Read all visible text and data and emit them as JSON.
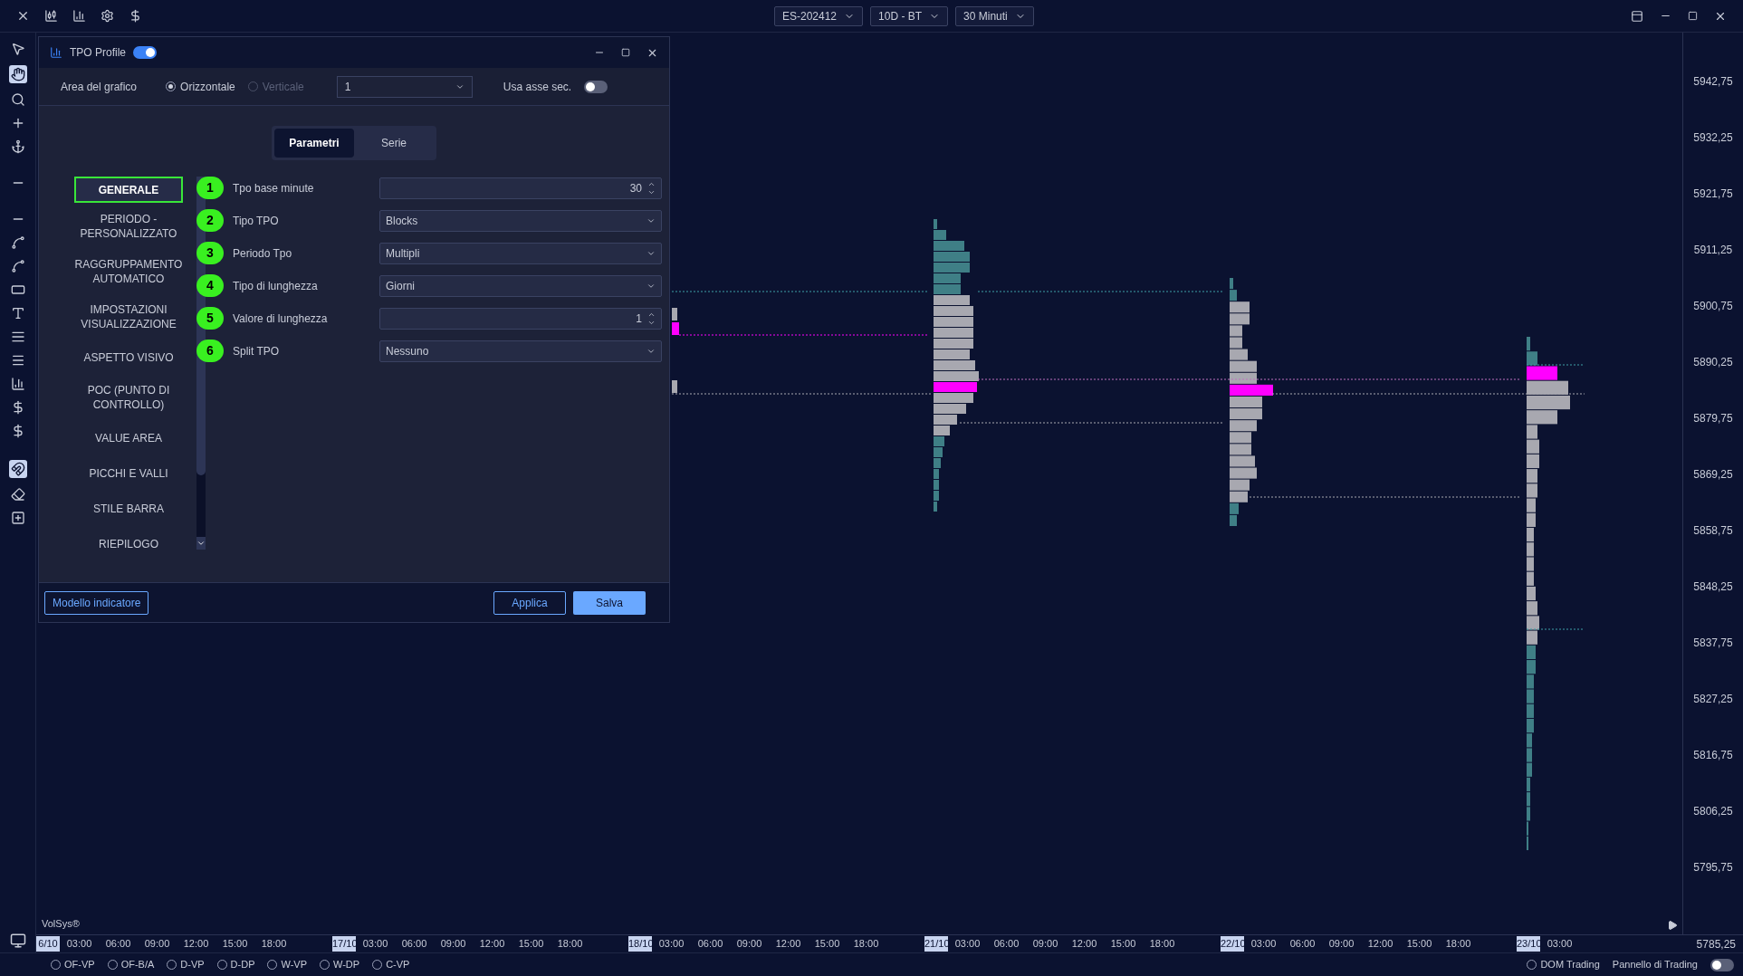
{
  "top_bar": {
    "dropdowns": [
      "ES-202412",
      "10D - BT",
      "30 Minuti"
    ]
  },
  "dialog": {
    "title": "TPO Profile",
    "enabled": true,
    "area": {
      "label": "Area del grafico",
      "options": [
        {
          "label": "Orizzontale",
          "selected": true,
          "disabled": false
        },
        {
          "label": "Verticale",
          "selected": false,
          "disabled": true
        }
      ],
      "select_value": "1",
      "secondary_axis": {
        "label": "Usa asse sec.",
        "on": false
      }
    },
    "tabs": [
      {
        "label": "Parametri",
        "selected": true
      },
      {
        "label": "Serie",
        "selected": false
      }
    ],
    "sections": [
      {
        "label": "GENERALE",
        "selected": true
      },
      {
        "label": "PERIODO - PERSONALIZZATO",
        "selected": false
      },
      {
        "label": "RAGGRUPPAMENTO AUTOMATICO",
        "selected": false
      },
      {
        "label": "IMPOSTAZIONI VISUALIZZAZIONE",
        "selected": false
      },
      {
        "label": "ASPETTO VISIVO",
        "selected": false
      },
      {
        "label": "POC (PUNTO DI CONTROLLO)",
        "selected": false
      },
      {
        "label": "VALUE AREA",
        "selected": false
      },
      {
        "label": "PICCHI E VALLI",
        "selected": false
      },
      {
        "label": "STILE BARRA",
        "selected": false
      },
      {
        "label": "RIEPILOGO",
        "selected": false
      }
    ],
    "params": [
      {
        "number": "1",
        "label": "Tpo base minute",
        "kind": "spinner",
        "value": "30"
      },
      {
        "number": "2",
        "label": "Tipo TPO",
        "kind": "dropdown",
        "value": "Blocks"
      },
      {
        "number": "3",
        "label": "Periodo Tpo",
        "kind": "dropdown",
        "value": "Multipli"
      },
      {
        "number": "4",
        "label": "Tipo di lunghezza",
        "kind": "dropdown",
        "value": "Giorni"
      },
      {
        "number": "5",
        "label": "Valore di lunghezza",
        "kind": "spinner",
        "value": "1"
      },
      {
        "number": "6",
        "label": "Split TPO",
        "kind": "dropdown",
        "value": "Nessuno"
      }
    ],
    "footer": {
      "template_button": "Modello indicatore",
      "buttons": [
        {
          "label": "Applica",
          "kind": "outline"
        },
        {
          "label": "Salva",
          "kind": "primary"
        }
      ]
    }
  },
  "chart": {
    "brand": "VolSys®",
    "price_axis": [
      "5942,75",
      "5932,25",
      "5921,75",
      "5911,25",
      "5900,75",
      "5890,25",
      "5879,75",
      "5869,25",
      "5858,75",
      "5848,25",
      "5837,75",
      "5827,25",
      "5816,75",
      "5806,25",
      "5795,75",
      "5785,25"
    ],
    "time_axis": [
      {
        "date": "6/10",
        "times": [
          "03:00",
          "06:00",
          "09:00",
          "12:00",
          "15:00",
          "18:00"
        ]
      },
      {
        "date": "17/10",
        "times": [
          "03:00",
          "06:00",
          "09:00",
          "12:00",
          "15:00",
          "18:00"
        ]
      },
      {
        "date": "18/10",
        "times": [
          "03:00",
          "06:00",
          "09:00",
          "12:00",
          "15:00",
          "18:00"
        ]
      },
      {
        "date": "21/10",
        "times": [
          "03:00",
          "06:00",
          "09:00",
          "12:00",
          "15:00",
          "18:00"
        ]
      },
      {
        "date": "22/10",
        "times": [
          "03:00",
          "06:00",
          "09:00",
          "12:00",
          "15:00",
          "18:00"
        ]
      },
      {
        "date": "23/10",
        "times": [
          "03:00"
        ]
      }
    ]
  },
  "bottom_bar": {
    "studies": [
      {
        "label": "OF-VP",
        "selected": false
      },
      {
        "label": "OF-B/A",
        "selected": false
      },
      {
        "label": "D-VP",
        "selected": false
      },
      {
        "label": "D-DP",
        "selected": false
      },
      {
        "label": "W-VP",
        "selected": false
      },
      {
        "label": "W-DP",
        "selected": false
      },
      {
        "label": "C-VP",
        "selected": false
      }
    ],
    "dom_trading": {
      "label": "DOM Trading",
      "selected": false
    },
    "trading_panel": {
      "label": "Pannello di Trading",
      "on": false
    }
  }
}
